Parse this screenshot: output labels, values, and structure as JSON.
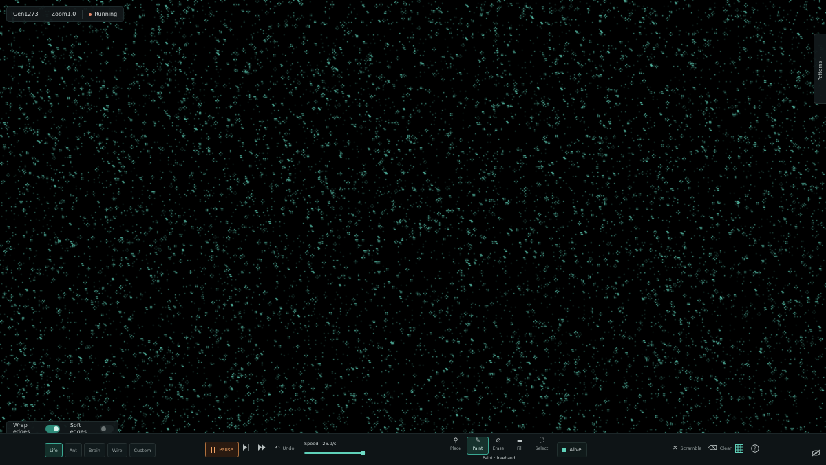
{
  "status": {
    "generation": "Gen1273",
    "zoom": "Zoom1.0",
    "state": "Running",
    "state_dot_color": "#e98a6a"
  },
  "patterns_panel": {
    "label": "Patterns",
    "icon": "chevron-up-icon"
  },
  "edges": {
    "wrap_label": "Wrap edges",
    "wrap_on": true,
    "soft_label": "Soft edges",
    "soft_on": false
  },
  "rules": [
    {
      "label": "Life",
      "active": true
    },
    {
      "label": "Ant",
      "active": false
    },
    {
      "label": "Brain",
      "active": false
    },
    {
      "label": "Wire",
      "active": false
    },
    {
      "label": "Custom",
      "active": false
    }
  ],
  "playback": {
    "pause_label": "Pause",
    "undo_label": "Undo",
    "speed_label": "Speed",
    "speed_value": "26.9/s",
    "speed_fraction": 0.95
  },
  "tools": [
    {
      "label": "Place",
      "icon": "pin-icon",
      "active": false
    },
    {
      "label": "Paint",
      "icon": "brush-icon",
      "active": true
    },
    {
      "label": "Erase",
      "icon": "erase-icon",
      "active": false
    },
    {
      "label": "Fill",
      "icon": "bucket-icon",
      "active": false
    },
    {
      "label": "Select",
      "icon": "select-icon",
      "active": false
    }
  ],
  "tool_mode": "Paint · freehand",
  "state_picker": {
    "label": "Alive",
    "color": "#5fd1b9"
  },
  "actions": {
    "scramble_label": "Scramble",
    "clear_label": "Clear"
  },
  "colors": {
    "cell": "#5fd1b9",
    "accent": "#3aa893",
    "pause_accent": "#f0a264",
    "background": "#000000"
  }
}
